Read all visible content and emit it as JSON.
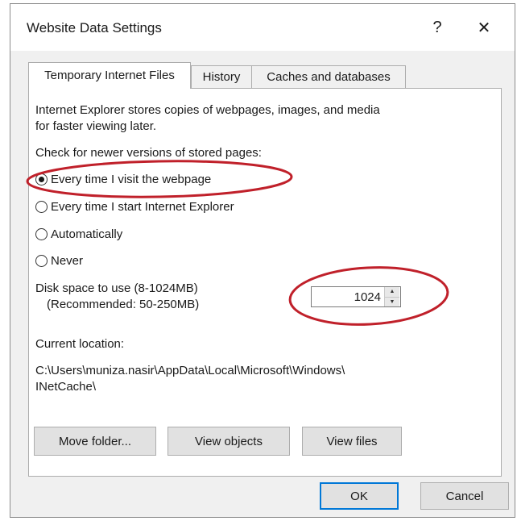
{
  "window": {
    "title": "Website Data Settings",
    "help_glyph": "?",
    "close_glyph": "✕"
  },
  "tabs": [
    {
      "label": "Temporary Internet Files",
      "active": true
    },
    {
      "label": "History",
      "active": false
    },
    {
      "label": "Caches and databases",
      "active": false
    }
  ],
  "panel": {
    "intro_line1": "Internet Explorer stores copies of webpages, images, and media",
    "intro_line2": "for faster viewing later.",
    "check_label": "Check for newer versions of stored pages:",
    "options": [
      {
        "label": "Every time I visit the webpage",
        "checked": true
      },
      {
        "label": "Every time I start Internet Explorer",
        "checked": false
      },
      {
        "label": "Automatically",
        "checked": false
      },
      {
        "label": "Never",
        "checked": false
      }
    ],
    "disk_label": "Disk space to use (8-1024MB)",
    "disk_recommended": "(Recommended: 50-250MB)",
    "disk_value": "1024",
    "location_label": "Current location:",
    "location_line1": "C:\\Users\\muniza.nasir\\AppData\\Local\\Microsoft\\Windows\\",
    "location_line2": "INetCache\\",
    "buttons": {
      "move_folder": "Move folder...",
      "view_objects": "View objects",
      "view_files": "View files"
    }
  },
  "footer": {
    "ok": "OK",
    "cancel": "Cancel"
  },
  "colors": {
    "annotation": "#c0202a",
    "accent": "#0078d7"
  }
}
